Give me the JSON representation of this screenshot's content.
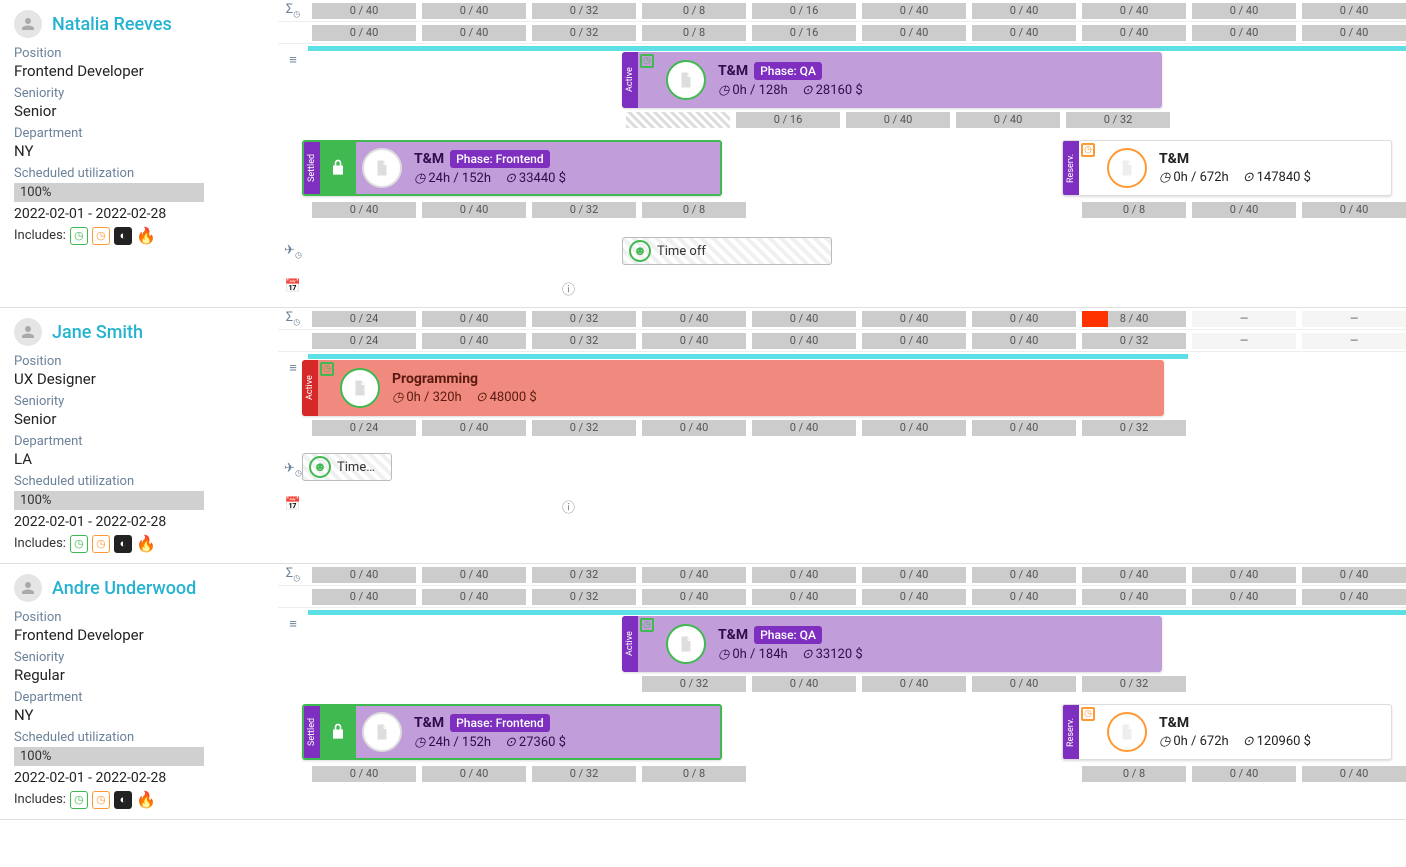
{
  "people": [
    {
      "name": "Natalia Reeves",
      "position": "Frontend Developer",
      "seniority": "Senior",
      "dept": "NY",
      "util": "100%",
      "range": "2022-02-01 - 2022-02-28",
      "includes": "Includes:",
      "sum1": [
        "0 / 40",
        "0 / 40",
        "0 / 32",
        "0 / 8",
        "0 / 16",
        "0 / 40",
        "0 / 40",
        "0 / 40",
        "0 / 40",
        "0 / 40"
      ],
      "sum2": [
        "0 / 40",
        "0 / 40",
        "0 / 32",
        "0 / 8",
        "0 / 16",
        "0 / 40",
        "0 / 40",
        "0 / 40",
        "0 / 40",
        "0 / 40"
      ],
      "qa_cells": [
        "",
        "",
        "",
        "0 / 16",
        "0 / 40",
        "0 / 40",
        "0 / 32"
      ],
      "qa": {
        "title": "T&M",
        "phase": "Phase: QA",
        "hours": "0h / 128h",
        "cost": "28160 $"
      },
      "fe_cells": [
        "0 / 40",
        "0 / 40",
        "0 / 32",
        "0 / 8"
      ],
      "fe": {
        "title": "T&M",
        "phase": "Phase: Frontend",
        "hours": "24h / 152h",
        "cost": "33440 $"
      },
      "res": {
        "title": "T&M",
        "hours": "0h / 672h",
        "cost": "147840 $"
      },
      "res_cells": [
        "0 / 8",
        "0 / 40",
        "0 / 40"
      ],
      "timeoff": "Time off"
    },
    {
      "name": "Jane Smith",
      "position": "UX Designer",
      "seniority": "Senior",
      "dept": "LA",
      "util": "100%",
      "range": "2022-02-01 - 2022-02-28",
      "includes": "Includes:",
      "sum1": [
        "0 / 24",
        "0 / 40",
        "0 / 32",
        "0 / 40",
        "0 / 40",
        "0 / 40",
        "0 / 40",
        "8 / 40",
        "—",
        "—"
      ],
      "sum2": [
        "0 / 24",
        "0 / 40",
        "0 / 32",
        "0 / 40",
        "0 / 40",
        "0 / 40",
        "0 / 40",
        "0 / 32",
        "—",
        "—"
      ],
      "prog": {
        "title": "Programming",
        "hours": "0h / 320h",
        "cost": "48000 $"
      },
      "prog_cells": [
        "0 / 24",
        "0 / 40",
        "0 / 32",
        "0 / 40",
        "0 / 40",
        "0 / 40",
        "0 / 40",
        "0 / 32"
      ],
      "timeoff": "Time…"
    },
    {
      "name": "Andre Underwood",
      "position": "Frontend Developer",
      "seniority": "Regular",
      "dept": "NY",
      "util": "100%",
      "range": "2022-02-01 - 2022-02-28",
      "includes": "Includes:",
      "sum1": [
        "0 / 40",
        "0 / 40",
        "0 / 32",
        "0 / 40",
        "0 / 40",
        "0 / 40",
        "0 / 40",
        "0 / 40",
        "0 / 40",
        "0 / 40"
      ],
      "sum2": [
        "0 / 40",
        "0 / 40",
        "0 / 32",
        "0 / 40",
        "0 / 40",
        "0 / 40",
        "0 / 40",
        "0 / 40",
        "0 / 40",
        "0 / 40"
      ],
      "qa_cells": [
        "",
        "",
        "",
        "0 / 32",
        "0 / 40",
        "0 / 40",
        "0 / 40",
        "0 / 32"
      ],
      "qa": {
        "title": "T&M",
        "phase": "Phase: QA",
        "hours": "0h / 184h",
        "cost": "33120 $"
      },
      "fe_cells": [
        "0 / 40",
        "0 / 40",
        "0 / 32",
        "0 / 8"
      ],
      "fe": {
        "title": "T&M",
        "phase": "Phase: Frontend",
        "hours": "24h / 152h",
        "cost": "27360 $"
      },
      "res": {
        "title": "T&M",
        "hours": "0h / 672h",
        "cost": "120960 $"
      },
      "res_cells": [
        "0 / 8",
        "0 / 40",
        "0 / 40"
      ]
    }
  ],
  "labels": {
    "pos": "Position",
    "sen": "Seniority",
    "dep": "Department",
    "su": "Scheduled utilization",
    "settled": "Settled",
    "active": "Active",
    "reserv": "Reserv."
  }
}
